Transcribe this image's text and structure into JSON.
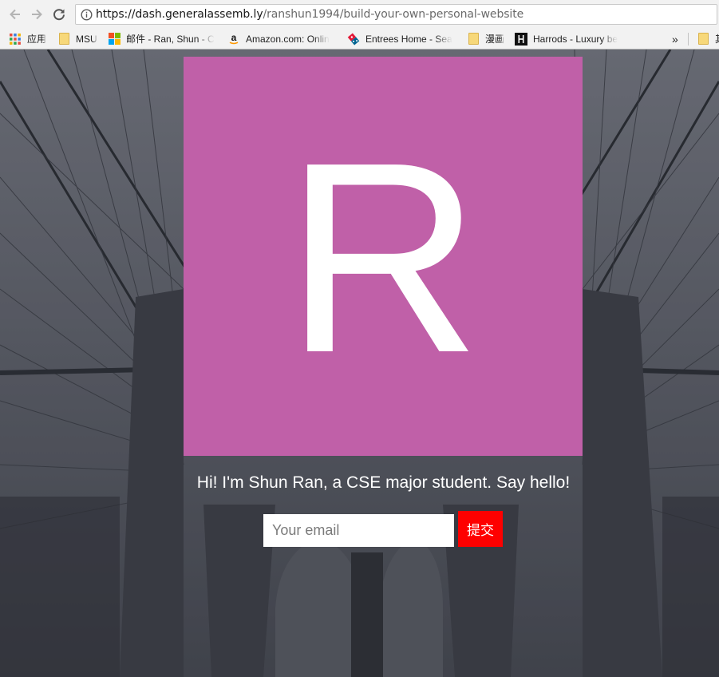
{
  "browser": {
    "url_host": "https://dash.generalassemb.ly",
    "url_path": "/ranshun1994/build-your-own-personal-website"
  },
  "bookmarks": [
    {
      "label": "应用",
      "icon": "apps-grid-icon"
    },
    {
      "label": "MSU",
      "icon": "folder-icon"
    },
    {
      "label": "邮件 - Ran, Shun - C",
      "icon": "microsoft-logo-icon"
    },
    {
      "label": "Amazon.com: Onlin",
      "icon": "amazon-logo-icon"
    },
    {
      "label": "Entrees Home - Sea",
      "icon": "dominos-logo-icon"
    },
    {
      "label": "漫画",
      "icon": "folder-icon"
    },
    {
      "label": "Harrods - Luxury be",
      "icon": "harrods-logo-icon"
    }
  ],
  "bookmarks_overflow": "»",
  "bookmarks_trailing_folder_label": "其",
  "page": {
    "logo_letter": "R",
    "tagline": "Hi! I'm Shun Ran, a CSE major student. Say hello!",
    "email_placeholder": "Your email",
    "submit_label": "提交"
  },
  "colors": {
    "logo_background": "#c060a8",
    "submit_background": "#fe0000",
    "page_background": "#54565f"
  }
}
